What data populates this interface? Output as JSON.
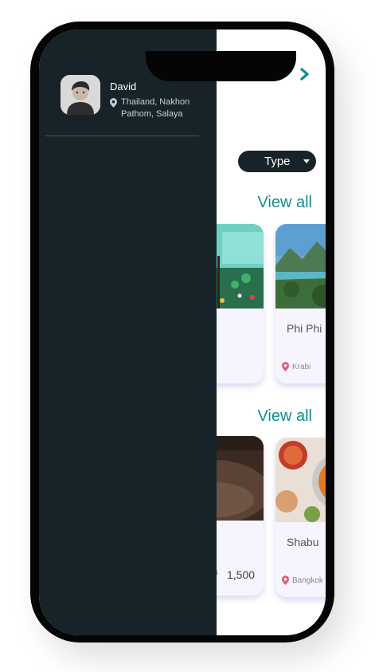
{
  "user": {
    "name": "David",
    "location": "Thailand, Nakhon Pathom, Salaya"
  },
  "filter": {
    "type_label": "Type"
  },
  "sections": [
    {
      "view_all_label": "View all",
      "cards": [
        {
          "title": "",
          "location": ""
        },
        {
          "title": "Phi Phi",
          "location": "Krabi"
        }
      ]
    },
    {
      "view_all_label": "View all",
      "cards": [
        {
          "title": "",
          "price_currency": "$",
          "price": "1,500"
        },
        {
          "title": "Shabu",
          "location": "Bangkok"
        }
      ]
    }
  ],
  "colors": {
    "drawer_bg": "#172329",
    "accent": "#128f8f",
    "card_bg": "#f6f5fd",
    "pin": "#e8567a"
  }
}
